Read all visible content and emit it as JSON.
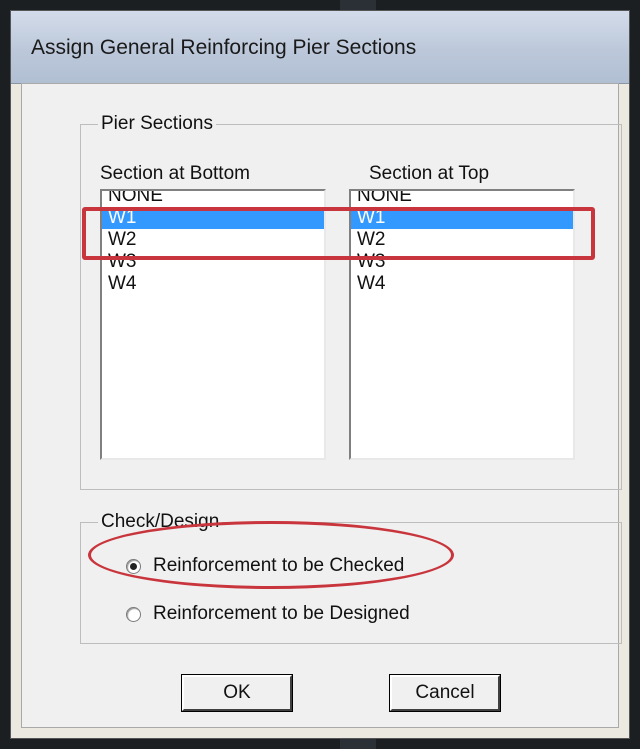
{
  "dialog": {
    "title": "Assign General Reinforcing Pier Sections"
  },
  "pier_sections": {
    "legend": "Pier Sections",
    "bottom": {
      "label": "Section at Bottom",
      "items": [
        "NONE",
        "W1",
        "W2",
        "W3",
        "W4"
      ],
      "selected": "W1"
    },
    "top": {
      "label": "Section at Top",
      "items": [
        "NONE",
        "W1",
        "W2",
        "W3",
        "W4"
      ],
      "selected": "W1"
    }
  },
  "check_design": {
    "legend": "Check/Design",
    "options": [
      {
        "label": "Reinforcement to be Checked",
        "checked": true
      },
      {
        "label": "Reinforcement to be Designed",
        "checked": false
      }
    ]
  },
  "buttons": {
    "ok": "OK",
    "cancel": "Cancel"
  },
  "annotation_color": "#c9353c",
  "selection_color": "#3399ff"
}
